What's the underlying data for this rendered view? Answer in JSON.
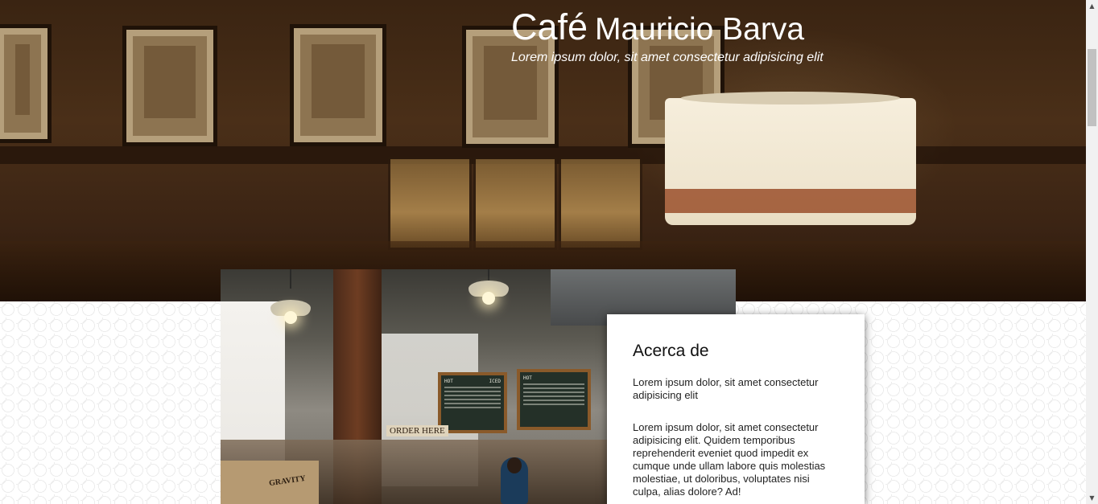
{
  "hero": {
    "title_part1": "Café",
    "title_part2": "Mauricio Barva",
    "subtitle": "Lorem ipsum dolor, sit amet consectetur adipisicing elit"
  },
  "photo": {
    "box_label": "GRAVITY",
    "order_sign": "ORDER HERE",
    "board_left_title": "HOT",
    "board_left_title2": "ICED",
    "board_right_title": "HOT"
  },
  "about": {
    "heading": "Acerca de",
    "paragraph1": "Lorem ipsum dolor, sit amet consectetur adipisicing elit",
    "paragraph2": "Lorem ipsum dolor, sit amet consectetur adipisicing elit. Quidem temporibus reprehenderit eveniet quod impedit ex cumque unde ullam labore quis molestias molestiae, ut doloribus, voluptates nisi culpa, alias dolore? Ad!"
  },
  "scrollbar": {
    "up_icon": "triangle-up",
    "down_icon": "triangle-down"
  }
}
